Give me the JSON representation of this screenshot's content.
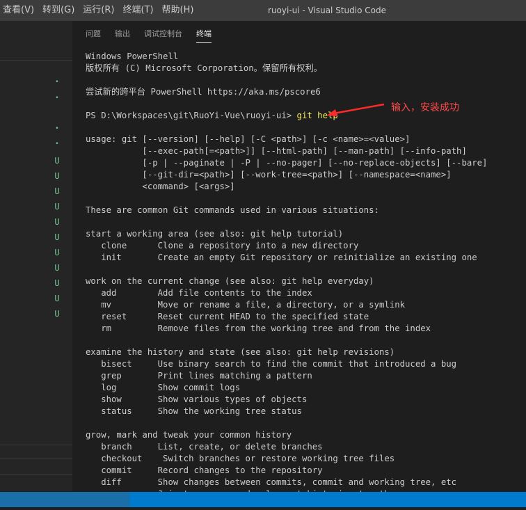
{
  "menu": [
    "查看(V)",
    "转到(G)",
    "运行(R)",
    "终端(T)",
    "帮助(H)"
  ],
  "window_title": "ruoyi-ui - Visual Studio Code",
  "panel_tabs": [
    "问题",
    "输出",
    "调试控制台",
    "终端"
  ],
  "active_tab": "终端",
  "sidebar_marks": [
    "•",
    "•",
    "•",
    "•",
    "U",
    "U",
    "U",
    "U",
    "U",
    "U",
    "U",
    "U",
    "U",
    "U",
    "U"
  ],
  "terminal": {
    "prompt": "PS D:\\Workspaces\\git\\RuoYi-Vue\\ruoyi-ui> ",
    "command": "git help",
    "lines": [
      "Windows PowerShell",
      "版权所有 (C) Microsoft Corporation。保留所有权利。",
      "",
      "尝试新的跨平台 PowerShell https://aka.ms/pscore6",
      "",
      "",
      "usage: git [--version] [--help] [-C <path>] [-c <name>=<value>]",
      "           [--exec-path[=<path>]] [--html-path] [--man-path] [--info-path]",
      "           [-p | --paginate | -P | --no-pager] [--no-replace-objects] [--bare]",
      "           [--git-dir=<path>] [--work-tree=<path>] [--namespace=<name>]",
      "           <command> [<args>]",
      "",
      "These are common Git commands used in various situations:",
      "",
      "start a working area (see also: git help tutorial)",
      "   clone      Clone a repository into a new directory",
      "   init       Create an empty Git repository or reinitialize an existing one",
      "",
      "work on the current change (see also: git help everyday)",
      "   add        Add file contents to the index",
      "   mv         Move or rename a file, a directory, or a symlink",
      "   reset      Reset current HEAD to the specified state",
      "   rm         Remove files from the working tree and from the index",
      "",
      "examine the history and state (see also: git help revisions)",
      "   bisect     Use binary search to find the commit that introduced a bug",
      "   grep       Print lines matching a pattern",
      "   log        Show commit logs",
      "   show       Show various types of objects",
      "   status     Show the working tree status",
      "",
      "grow, mark and tweak your common history",
      "   branch     List, create, or delete branches",
      "   checkout    Switch branches or restore working tree files",
      "   commit     Record changes to the repository",
      "   diff       Show changes between commits, commit and working tree, etc",
      "   merge      Join two or more development histories together"
    ]
  },
  "annotation": {
    "text": "输入，安装成功",
    "color": "#ff4a4a"
  },
  "colors": {
    "titlebar": "#3c3c3c",
    "sidebar": "#252526",
    "terminal_bg": "#1e1e1e",
    "statusbar": "#007acc",
    "git_untracked": "#73c991",
    "command": "#f2ea5e"
  }
}
